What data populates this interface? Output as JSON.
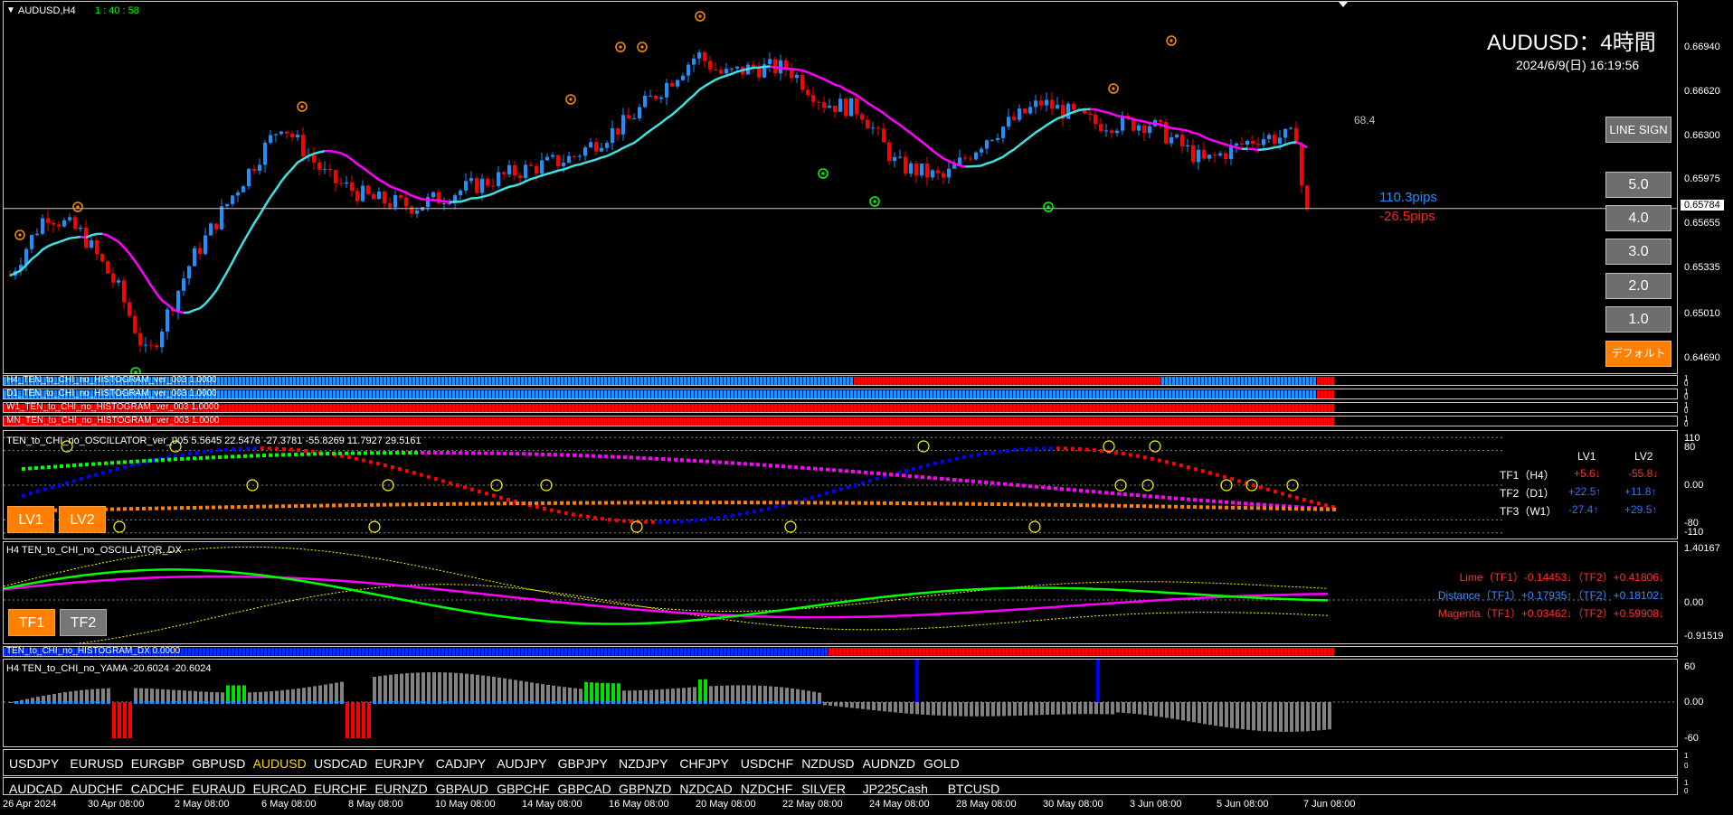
{
  "header": {
    "symbol": "AUDUSD,H4",
    "timer": "1 : 40 : 58",
    "title": "AUDUSD：4時間",
    "datetime": "2024/6/9(日) 16:19:56",
    "value_label": "68.4"
  },
  "price_scale": [
    "0.66940",
    "0.66620",
    "0.66300",
    "0.65975",
    "0.65655",
    "0.65335",
    "0.65010",
    "0.64690"
  ],
  "current_price": "0.65784",
  "pips": {
    "up": "110.3pips",
    "down": "-26.5pips"
  },
  "buttons": {
    "line_sign": "LINE SIGN",
    "levels": [
      "5.0",
      "4.0",
      "3.0",
      "2.0",
      "1.0"
    ],
    "default": "デフォルト"
  },
  "histograms": [
    {
      "label": "H4_TEN_to_CHI_no_HISTOGRAM_ver_003 1.0000"
    },
    {
      "label": "D1_TEN_to_CHI_no_HISTOGRAM_ver_003 1.0000"
    },
    {
      "label": "W1_TEN_to_CHI_no_HISTOGRAM_ver_003 1.0000"
    },
    {
      "label": "MN_TEN_to_CHI_no_HISTOGRAM_ver_003 1.0000"
    }
  ],
  "histogram_scale": [
    "1",
    "0"
  ],
  "oscillator": {
    "label": "TEN_to_CHI_no_OSCILLATOR_ver_005 5.5645 22.5476 -27.3781 -55.8269 11.7927 29.5161",
    "scale": [
      "110",
      "80",
      "0.00",
      "-80",
      "-110"
    ],
    "buttons": [
      "LV1",
      "LV2"
    ],
    "table": {
      "headers": [
        "LV1",
        "LV2"
      ],
      "rows": [
        {
          "name": "TF1（H4）",
          "lv1": "+5.6↓",
          "lv2": "-55.8↓"
        },
        {
          "name": "TF2（D1）",
          "lv1": "+22.5↑",
          "lv2": "+11.8↑"
        },
        {
          "name": "TF3（W1）",
          "lv1": "-27.4↑",
          "lv2": "+29.5↑"
        }
      ]
    }
  },
  "dx": {
    "label": "H4 TEN_to_CHI_no_OSCILLATOR_DX",
    "scale": [
      "1.40167",
      "0.00",
      "-0.91519"
    ],
    "buttons": [
      "TF1",
      "TF2"
    ],
    "lines": [
      "Lime（TF1）-0.14453↓（TF2）+0.41806↓",
      "Distance（TF1）+0.17935↑（TF2）+0.18102↓",
      "Magenta（TF1）+0.03462↓（TF2）+0.59908↓"
    ]
  },
  "hist_dx": {
    "label": "TEN_to_CHI_no_HISTOGRAM_DX 0.0000"
  },
  "yama": {
    "label": "H4  TEN_to_CHI_no_YAMA  -20.6024  -20.6024",
    "scale": [
      "60",
      "0.00",
      "-60"
    ]
  },
  "symbols_row1": [
    "USDJPY",
    "EURUSD",
    "EURGBP",
    "GBPUSD",
    "AUDUSD",
    "USDCAD",
    "EURJPY",
    "CADJPY",
    "AUDJPY",
    "GBPJPY",
    "NZDJPY",
    "CHFJPY",
    "USDCHF",
    "NZDUSD",
    "AUDNZD",
    "GOLD"
  ],
  "symbols_row2": [
    "AUDCAD",
    "AUDCHF",
    "CADCHF",
    "EURAUD",
    "EURCAD",
    "EURCHF",
    "EURNZD",
    "GBPAUD",
    "GBPCHF",
    "GBPCAD",
    "GBPNZD",
    "NZDCAD",
    "NZDCHF",
    "SILVER",
    "JP225Cash",
    "BTCUSD"
  ],
  "active_symbol": "AUDUSD",
  "time_axis": [
    "26 Apr 2024",
    "30 Apr 08:00",
    "2 May 08:00",
    "6 May 08:00",
    "8 May 08:00",
    "10 May 08:00",
    "14 May 08:00",
    "16 May 08:00",
    "20 May 08:00",
    "22 May 08:00",
    "24 May 08:00",
    "28 May 08:00",
    "30 May 08:00",
    "3 Jun 08:00",
    "5 Jun 08:00",
    "7 Jun 08:00"
  ],
  "colors": {
    "bull": "#1e90ff",
    "bear": "#ff0000",
    "ma_cyan": "#40e0e0",
    "ma_magenta": "#ff00ff",
    "lime": "#00ff00",
    "orange": "#ff8000",
    "yellow": "#ffff00",
    "active": "#ffd700"
  }
}
